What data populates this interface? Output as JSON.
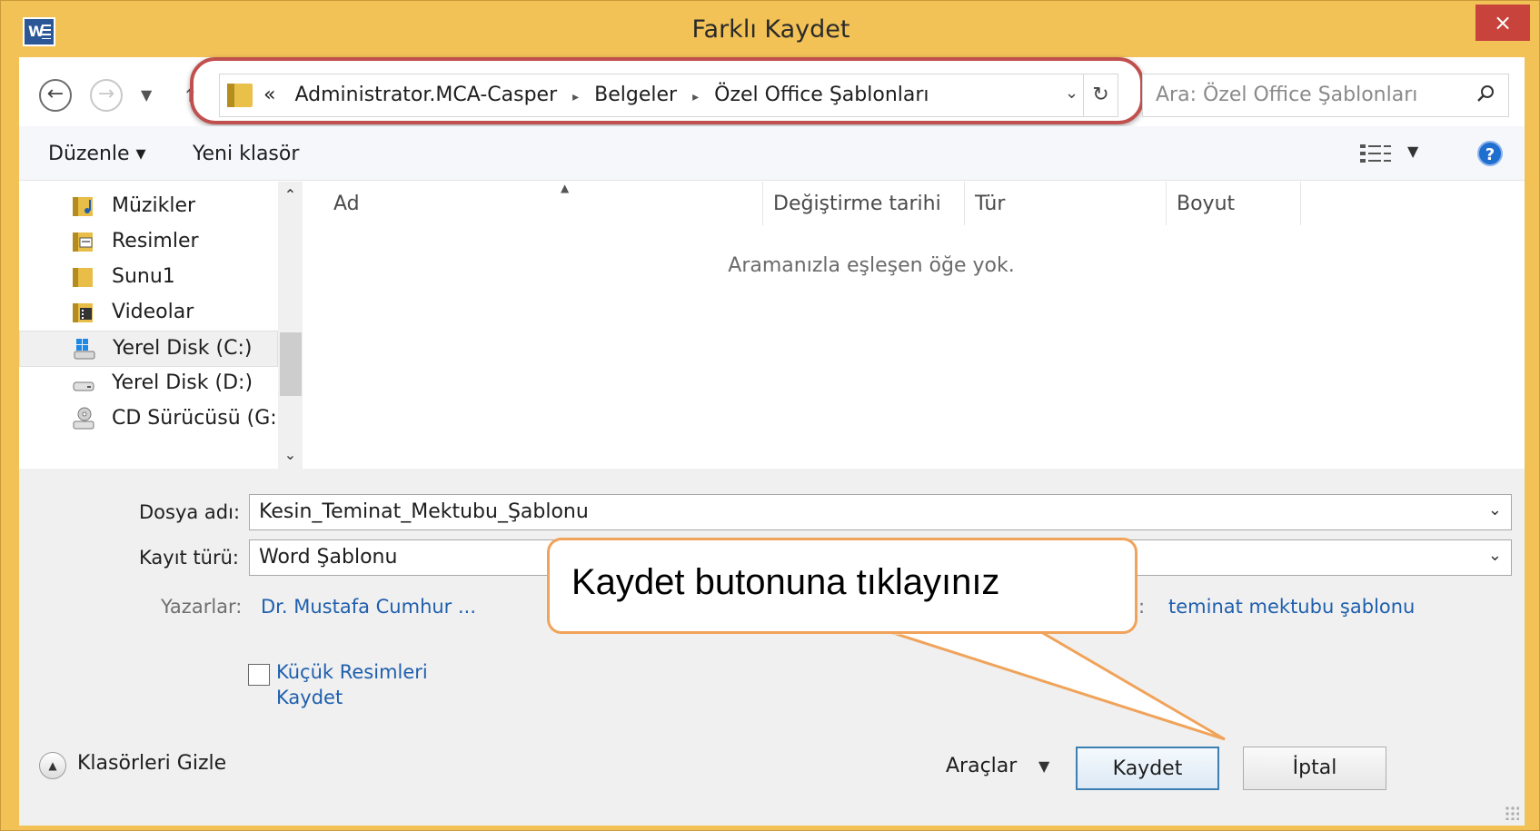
{
  "window": {
    "title": "Farklı Kaydet",
    "close_label": "×",
    "app_icon_letter": "W"
  },
  "address": {
    "overflow": "«",
    "crumbs": [
      "Administrator.MCA-Casper",
      "Belgeler",
      "Özel Office Şablonları"
    ],
    "separator": "▸"
  },
  "search": {
    "placeholder": "Ara: Özel Office Şablonları"
  },
  "toolbar": {
    "organize_label": "Düzenle ▾",
    "new_folder_label": "Yeni klasör",
    "help_label": "?"
  },
  "sidebar": {
    "items": [
      {
        "label": "Müzikler",
        "icon": "music-folder-icon"
      },
      {
        "label": "Resimler",
        "icon": "pictures-folder-icon"
      },
      {
        "label": "Sunu1",
        "icon": "folder-icon"
      },
      {
        "label": "Videolar",
        "icon": "videos-folder-icon"
      },
      {
        "label": "Yerel Disk (C:)",
        "icon": "system-drive-icon"
      },
      {
        "label": "Yerel Disk (D:)",
        "icon": "drive-icon"
      },
      {
        "label": "CD Sürücüsü (G:)",
        "icon": "cd-drive-icon"
      }
    ]
  },
  "filelist": {
    "columns": [
      "Ad",
      "Değiştirme tarihi",
      "Tür",
      "Boyut"
    ],
    "empty_message": "Aramanızla eşleşen öğe yok."
  },
  "form": {
    "filename_label": "Dosya adı:",
    "filename_value": "Kesin_Teminat_Mektubu_Şablonu",
    "filetype_label": "Kayıt türü:",
    "filetype_value": "Word Şablonu",
    "authors_label": "Yazarlar:",
    "authors_value": "Dr. Mustafa Cumhur ...",
    "tags_label": ":",
    "tags_value": "teminat mektubu şablonu",
    "thumbnail_label": "Küçük Resimleri Kaydet"
  },
  "footer": {
    "hide_folders_label": "Klasörleri Gizle",
    "tools_label": "Araçlar",
    "save_label": "Kaydet",
    "cancel_label": "İptal"
  },
  "callout": {
    "text": "Kaydet butonuna tıklayınız",
    "border_color": "#f0a35a"
  },
  "colors": {
    "frame": "#f3c257",
    "close": "#c7433b",
    "highlight": "#c0504d",
    "link": "#1f5fad"
  }
}
